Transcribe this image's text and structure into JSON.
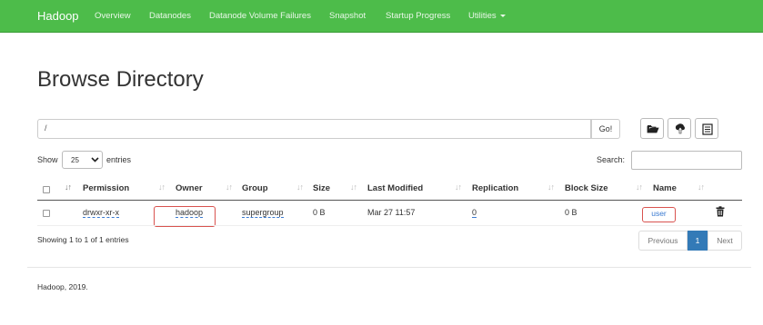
{
  "navbar": {
    "brand": "Hadoop",
    "links": [
      "Overview",
      "Datanodes",
      "Datanode Volume Failures",
      "Snapshot",
      "Startup Progress",
      "Utilities"
    ],
    "background": "#4dbc4a"
  },
  "page": {
    "title": "Browse Directory"
  },
  "toolbar": {
    "path_value": "/",
    "go_label": "Go!",
    "icons": [
      "folder-open-icon",
      "upload-icon",
      "list-icon"
    ]
  },
  "table_controls": {
    "show_label": "Show",
    "page_length": "25",
    "entries_label": "entries",
    "search_label": "Search:",
    "search_value": ""
  },
  "table": {
    "headers": [
      "Permission",
      "Owner",
      "Group",
      "Size",
      "Last Modified",
      "Replication",
      "Block Size",
      "Name"
    ],
    "rows": [
      {
        "permission": "drwxr-xr-x",
        "owner": "hadoop",
        "group": "supergroup",
        "size": "0 B",
        "last_modified": "Mar 27 11:57",
        "replication": "0",
        "block_size": "0 B",
        "name": "user"
      }
    ],
    "highlight_color": "#d9534f"
  },
  "pagination": {
    "info": "Showing 1 to 1 of 1 entries",
    "previous_label": "Previous",
    "current_page": "1",
    "next_label": "Next"
  },
  "footer": {
    "text": "Hadoop, 2019."
  }
}
